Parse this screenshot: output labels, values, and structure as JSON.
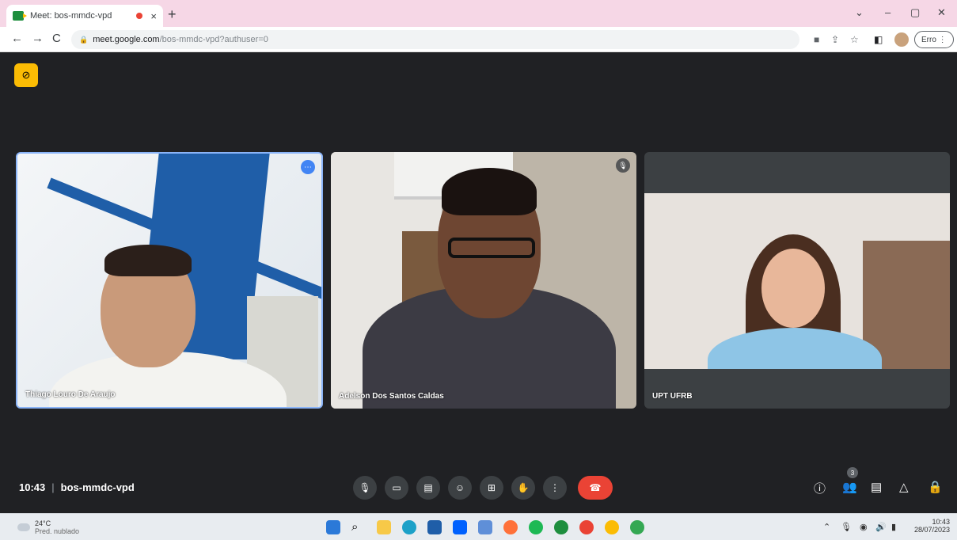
{
  "browser": {
    "tab_title": "Meet: bos-mmdc-vpd",
    "tab_close": "×",
    "new_tab": "+",
    "url_host": "meet.google.com",
    "url_path": "/bos-mmdc-vpd?authuser=0",
    "error_button": "Erro ⋮",
    "window_controls": [
      "⌄",
      "–",
      "▢",
      "✕"
    ]
  },
  "meet": {
    "participants": [
      {
        "name": "Thiago Louro De Araujo"
      },
      {
        "name": "Adelson Dos Santos Caldas"
      },
      {
        "name": "UPT UFRB"
      }
    ],
    "time": "10:43",
    "separator": "|",
    "meeting_code": "bos-mmdc-vpd",
    "participant_count": "3",
    "controls": [
      "mic",
      "camera",
      "captions",
      "emoji",
      "present",
      "raise-hand",
      "more",
      "end-call"
    ],
    "right_controls": [
      "info",
      "people",
      "chat",
      "activities",
      "host-controls"
    ]
  },
  "taskbar": {
    "temperature": "24°C",
    "condition": "Pred. nublado",
    "clock_time": "10:43",
    "clock_date": "28/07/2023"
  },
  "colors": {
    "accent_blue": "#4285f4",
    "end_call_red": "#ea4335",
    "badge_yellow": "#fbbc04",
    "background": "#202124"
  }
}
